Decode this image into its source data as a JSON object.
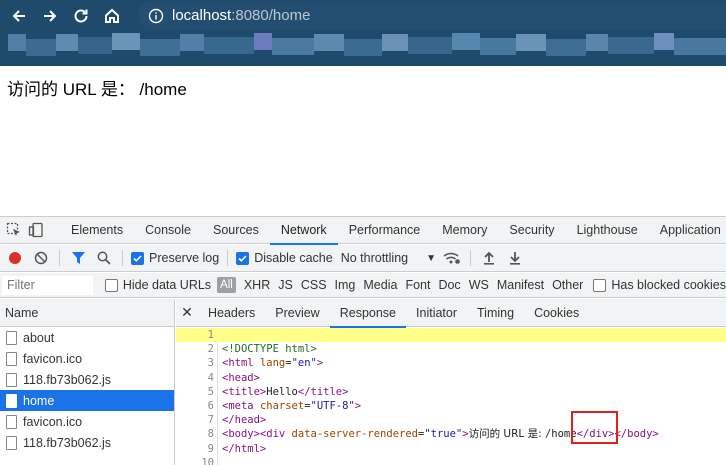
{
  "browser": {
    "url_host": "localhost",
    "url_rest": ":8080/home",
    "colors": {
      "chrome": "#1e4a6c",
      "omnibox": "#234e71"
    }
  },
  "page": {
    "text": "访问的 URL 是： /home"
  },
  "devtools": {
    "tabs": [
      "Elements",
      "Console",
      "Sources",
      "Network",
      "Performance",
      "Memory",
      "Security",
      "Lighthouse",
      "Application"
    ],
    "active_tab": "Network",
    "toolbar": {
      "preserve_log": "Preserve log",
      "disable_cache": "Disable cache",
      "throttling": "No throttling"
    },
    "filter": {
      "placeholder": "Filter",
      "hide_data_urls": "Hide data URLs",
      "all": "All",
      "types": [
        "XHR",
        "JS",
        "CSS",
        "Img",
        "Media",
        "Font",
        "Doc",
        "WS",
        "Manifest",
        "Other"
      ],
      "has_blocked": "Has blocked cookies"
    },
    "name_header": "Name",
    "requests": [
      {
        "name": "about",
        "selected": false
      },
      {
        "name": "favicon.ico",
        "selected": false
      },
      {
        "name": "118.fb73b062.js",
        "selected": false
      },
      {
        "name": "home",
        "selected": true
      },
      {
        "name": "favicon.ico",
        "selected": false
      },
      {
        "name": "118.fb73b062.js",
        "selected": false
      }
    ],
    "detail_tabs": [
      "Headers",
      "Preview",
      "Response",
      "Initiator",
      "Timing",
      "Cookies"
    ],
    "active_detail_tab": "Response",
    "response": {
      "line_numbers": [
        "1",
        "2",
        "3",
        "4",
        "5",
        "6",
        "7",
        "8",
        "9",
        "10"
      ],
      "l2": "<!DOCTYPE html>",
      "l3_open": "<html ",
      "l3_attr": "lang",
      "l3_eq": "=",
      "l3_val": "\"en\"",
      "l3_close": ">",
      "l4": "<head>",
      "l5_open": "<title>",
      "l5_text": "Hello",
      "l5_close": "</title>",
      "l6_open": "<meta ",
      "l6_attr": "charset",
      "l6_eq": "=",
      "l6_val": "\"UTF-8\"",
      "l6_close": ">",
      "l7": "</head>",
      "l8_open": "<body><div ",
      "l8_attr": "data-server-rendered",
      "l8_eq": "=",
      "l8_val": "\"true\"",
      "l8_gt": ">",
      "l8_text": "访问的 URL 是: ",
      "l8_path": "/home",
      "l8_close": "</div></body>",
      "l9": "</html>"
    }
  }
}
